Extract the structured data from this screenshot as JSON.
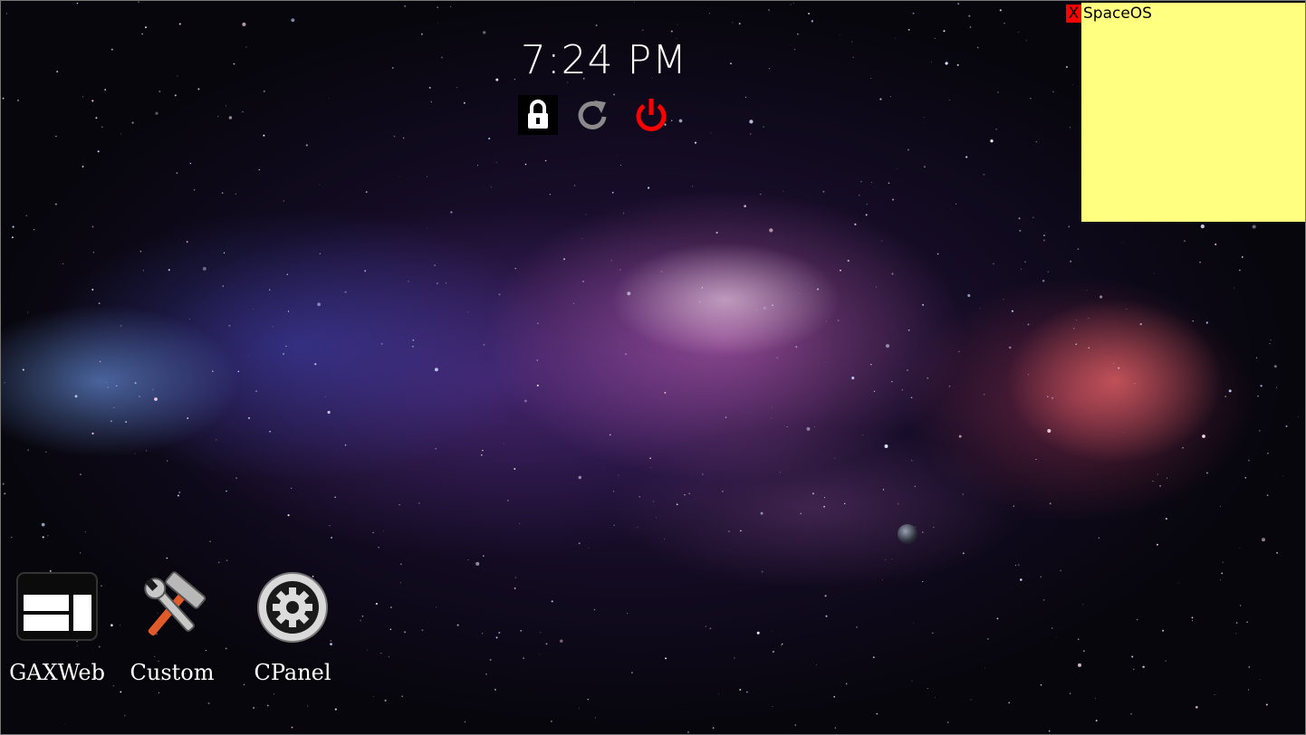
{
  "clock": {
    "time": "7:24 PM"
  },
  "system_buttons": [
    {
      "name": "lock",
      "icon": "lock-icon",
      "color": "#ffffff"
    },
    {
      "name": "restart",
      "icon": "restart-icon",
      "color": "#8a8a8a"
    },
    {
      "name": "power",
      "icon": "power-icon",
      "color": "#ff0000"
    }
  ],
  "sticky_note": {
    "close_label": "X",
    "title": "SpaceOS",
    "background": "#ffff80",
    "close_color": "#ff0000"
  },
  "desktop_icons": [
    {
      "label": "GAXWeb",
      "icon": "gaxweb-icon"
    },
    {
      "label": "Custom",
      "icon": "tools-icon"
    },
    {
      "label": "CPanel",
      "icon": "control-panel-icon"
    }
  ]
}
